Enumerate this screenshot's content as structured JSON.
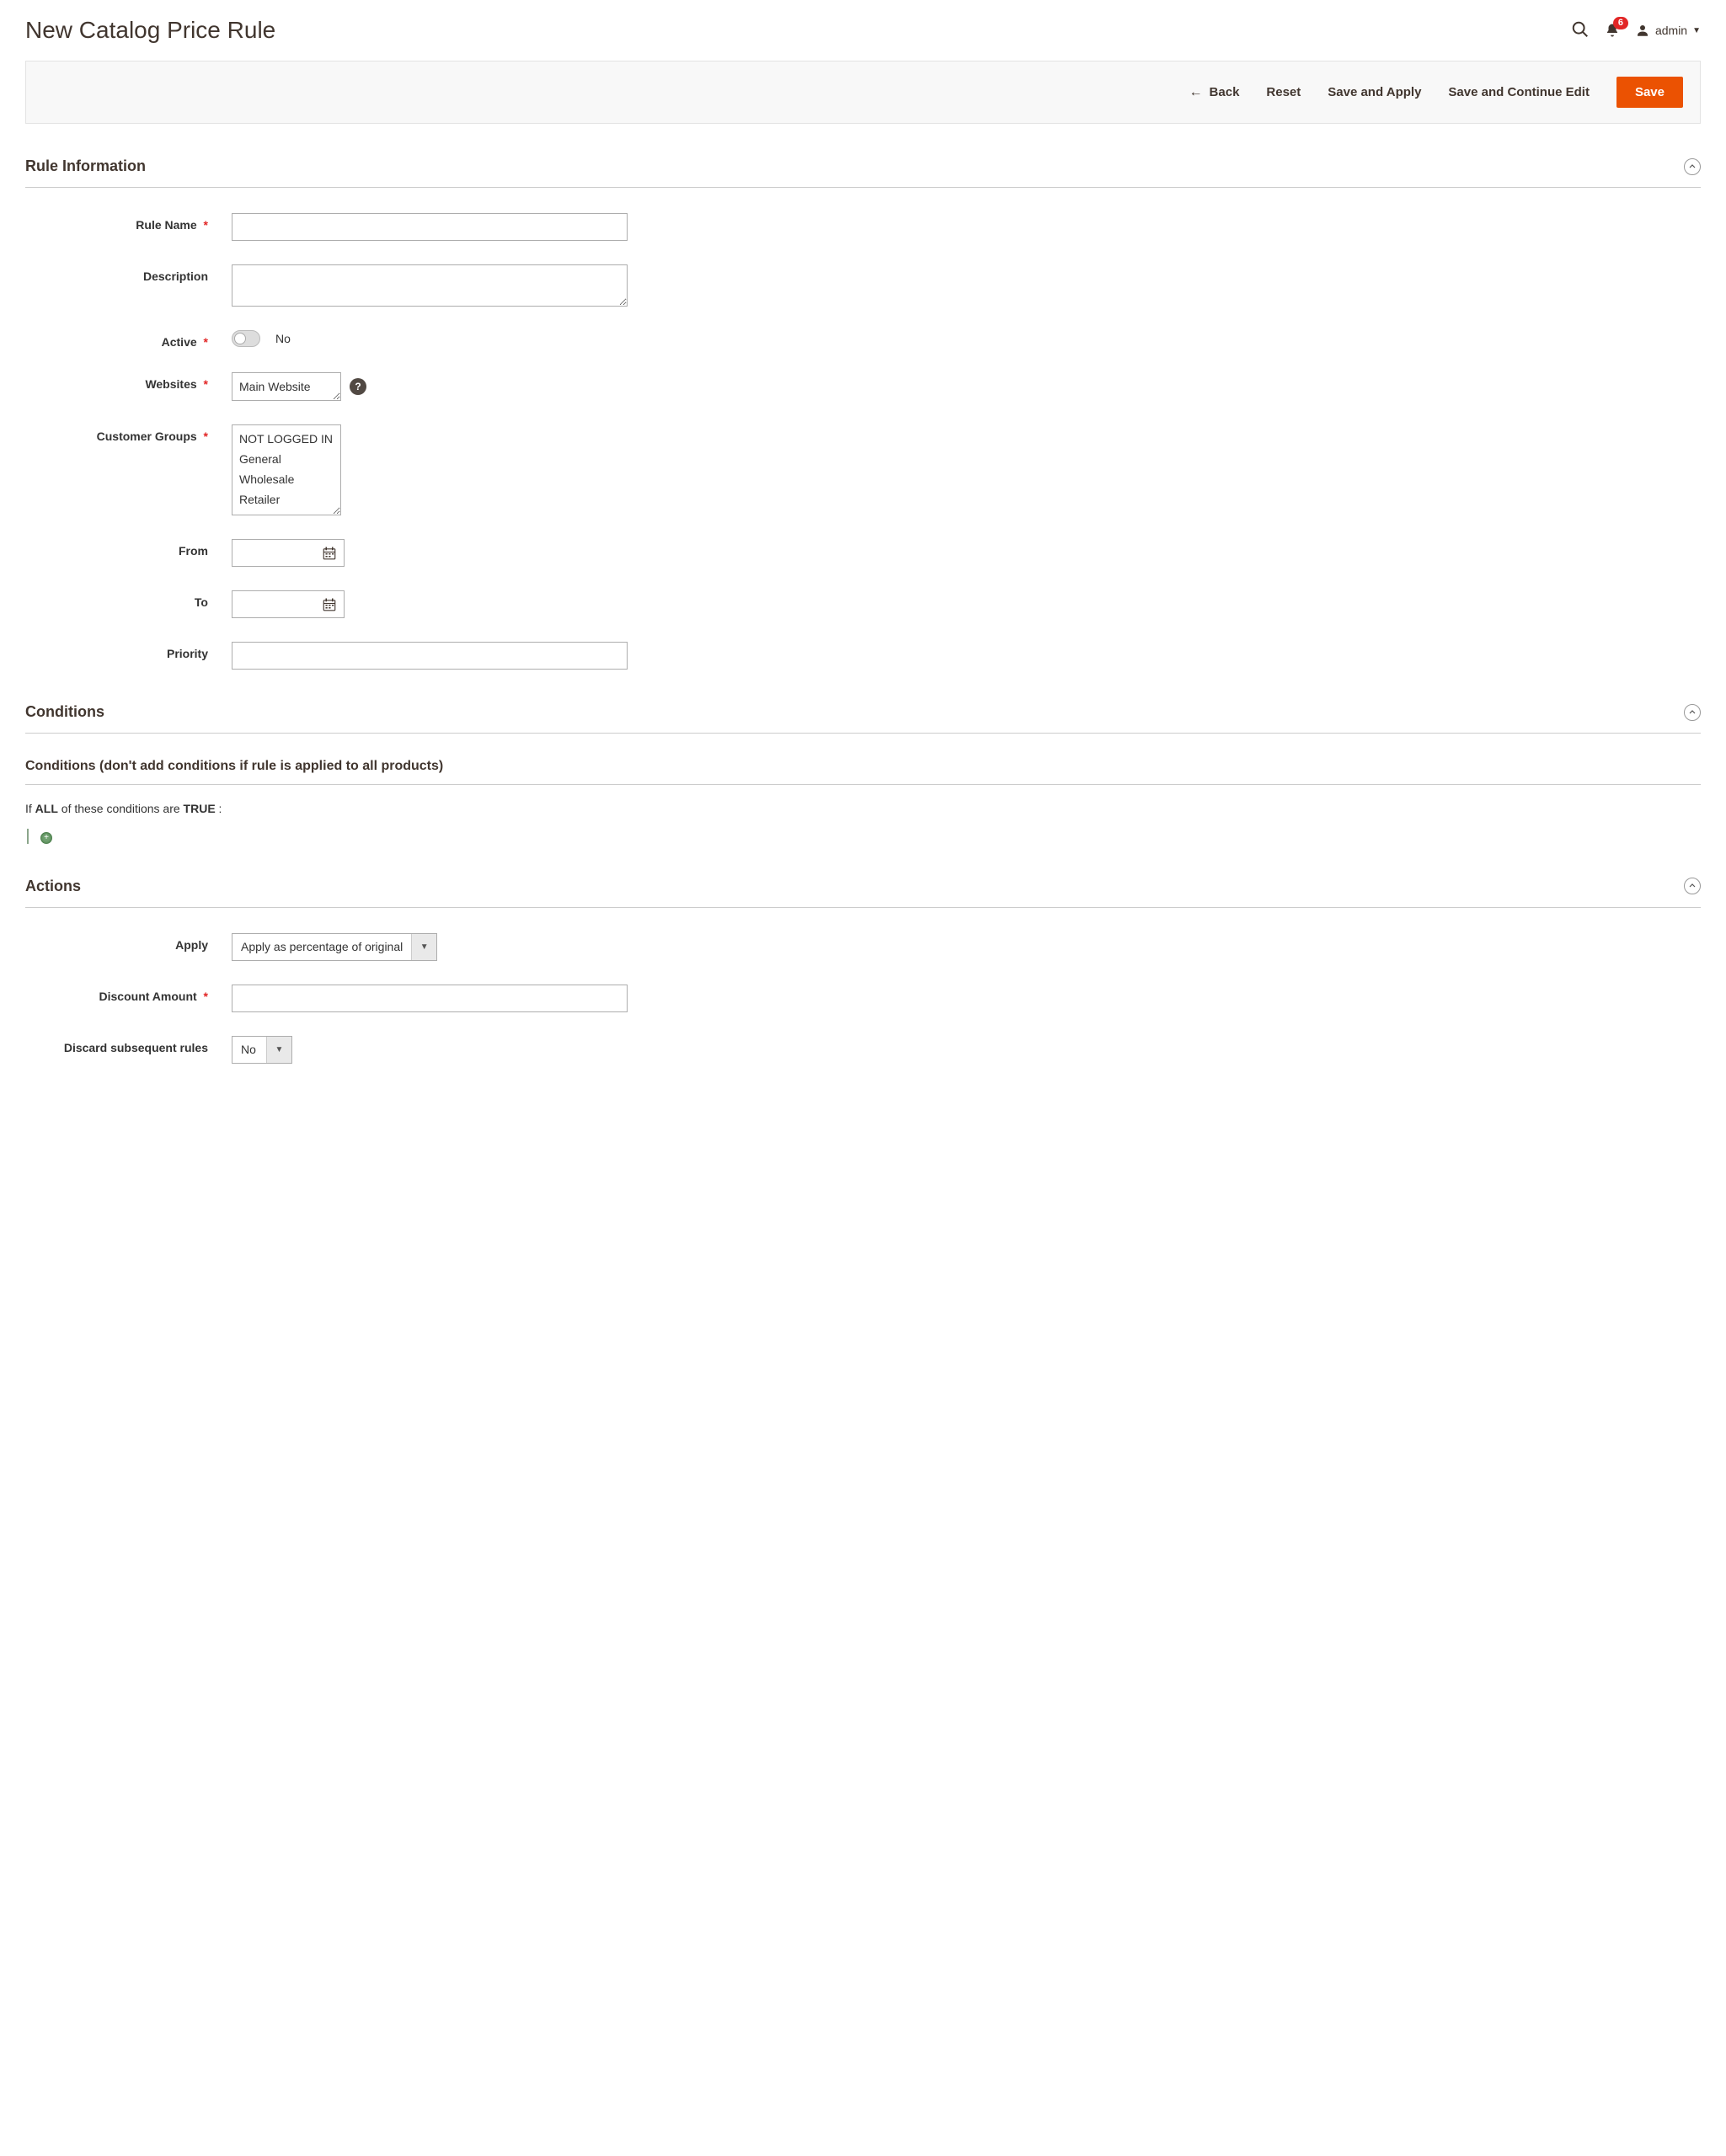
{
  "page_title": "New Catalog Price Rule",
  "header": {
    "notif_count": "6",
    "admin_name": "admin"
  },
  "actions": {
    "back": "Back",
    "reset": "Reset",
    "save_apply": "Save and Apply",
    "save_continue": "Save and Continue Edit",
    "save": "Save"
  },
  "sections": {
    "rule_info": "Rule Information",
    "conditions": "Conditions",
    "actions": "Actions"
  },
  "fields": {
    "rule_name": {
      "label": "Rule Name",
      "value": ""
    },
    "description": {
      "label": "Description",
      "value": ""
    },
    "active": {
      "label": "Active",
      "value": "No"
    },
    "websites": {
      "label": "Websites",
      "options": [
        "Main Website"
      ]
    },
    "customer_groups": {
      "label": "Customer Groups",
      "options": [
        "NOT LOGGED IN",
        "General",
        "Wholesale",
        "Retailer"
      ]
    },
    "from": {
      "label": "From",
      "value": ""
    },
    "to": {
      "label": "To",
      "value": ""
    },
    "priority": {
      "label": "Priority",
      "value": ""
    },
    "apply": {
      "label": "Apply",
      "value": "Apply as percentage of original"
    },
    "discount_amount": {
      "label": "Discount Amount",
      "value": ""
    },
    "discard": {
      "label": "Discard subsequent rules",
      "value": "No"
    }
  },
  "conditions_block": {
    "sub_heading": "Conditions (don't add conditions if rule is applied to all products)",
    "if_prefix": "If ",
    "all": "ALL",
    "mid": "  of these conditions are ",
    "true": "TRUE",
    "suffix": " :"
  }
}
